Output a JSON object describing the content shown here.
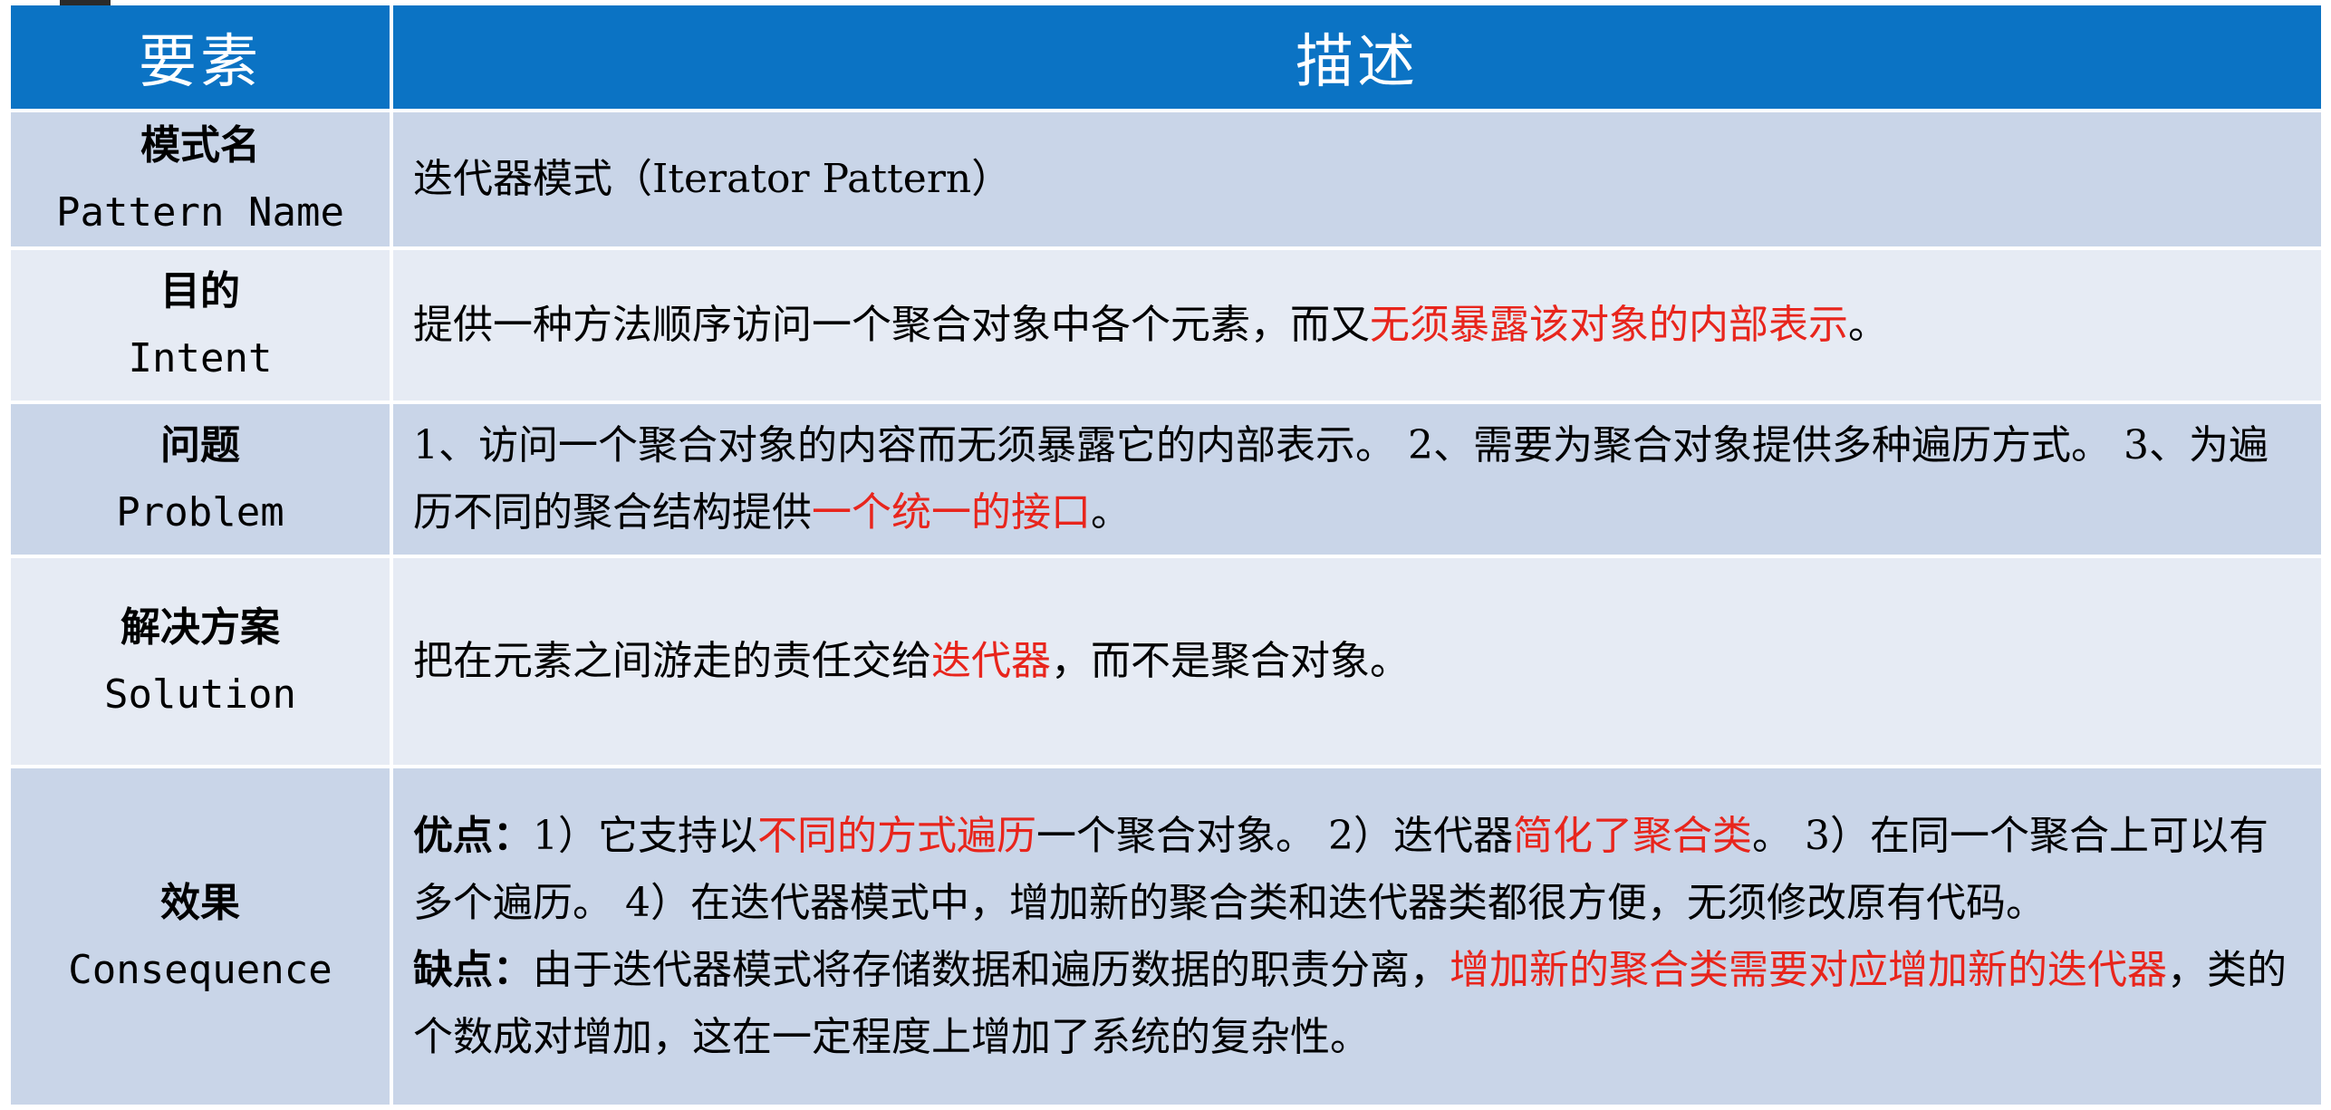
{
  "header": {
    "col1": "要素",
    "col2": "描述"
  },
  "rows": [
    {
      "zh": "模式名",
      "en": "Pattern Name",
      "desc": {
        "t1": "迭代器模式（Iterator Pattern）"
      }
    },
    {
      "zh": "目的",
      "en": "Intent",
      "desc": {
        "t1": "提供一种方法顺序访问一个聚合对象中各个元素，而又",
        "r1": "无须暴露该对象的内部表示",
        "t2": "。"
      }
    },
    {
      "zh": "问题",
      "en": "Problem",
      "desc": {
        "t1": "1、访问一个聚合对象的内容而无须暴露它的内部表示。 2、需要为聚合对象提供多种遍历方式。 3、为遍历不同的聚合结构提供",
        "r1": "一个统一的接口",
        "t2": "。"
      }
    },
    {
      "zh": "解决方案",
      "en": "Solution",
      "desc": {
        "t1": "把在元素之间游走的责任交给",
        "r1": "迭代器",
        "t2": "，而不是聚合对象。"
      }
    },
    {
      "zh": "效果",
      "en": "Consequence",
      "desc": {
        "pro_label": "优点：",
        "pro_t1": "1）它支持以",
        "pro_r1": "不同的方式遍历",
        "pro_t2": "一个聚合对象。 2）迭代器",
        "pro_r2": "简化了聚合类",
        "pro_t3": "。 3）在同一个聚合上可以有多个遍历。 4）在迭代器模式中，增加新的聚合类和迭代器类都很方便，无须修改原有代码。",
        "con_label": "缺点：",
        "con_t1": "由于迭代器模式将存储数据和遍历数据的职责分离，",
        "con_r1": "增加新的聚合类需要对应增加新的迭代器",
        "con_t2": "，类的个数成对增加，这在一定程度上增加了系统的复杂性。"
      }
    }
  ],
  "colors": {
    "header_bg": "#0b73c4",
    "row_dark": "#c9d5e8",
    "row_light": "#e6ebf4",
    "emphasis": "#e8251c"
  }
}
